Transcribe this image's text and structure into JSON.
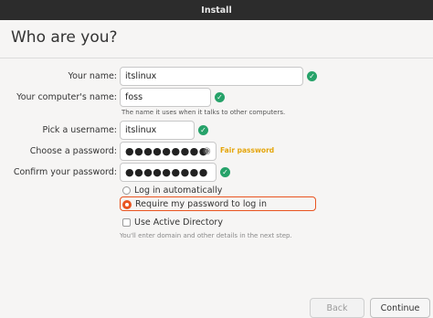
{
  "window": {
    "title": "Install"
  },
  "page": {
    "title": "Who are you?"
  },
  "form": {
    "name": {
      "label": "Your name:",
      "value": "itslinux"
    },
    "computer": {
      "label": "Your computer's name:",
      "value": "foss",
      "hint": "The name it uses when it talks to other computers."
    },
    "username": {
      "label": "Pick a username:",
      "value": "itslinux"
    },
    "password": {
      "label": "Choose a password:",
      "value": "●●●●●●●●●",
      "strength": "Fair password"
    },
    "confirm": {
      "label": "Confirm your password:",
      "value": "●●●●●●●●●"
    }
  },
  "options": {
    "auto_login": {
      "label": "Log in automatically",
      "selected": false
    },
    "require_password": {
      "label": "Require my password to log in",
      "selected": true
    },
    "active_directory": {
      "label": "Use Active Directory",
      "checked": false
    },
    "note": "You'll enter domain and other details in the next step."
  },
  "buttons": {
    "back": "Back",
    "continue": "Continue"
  },
  "colors": {
    "accent": "#e95420",
    "valid": "#26a269",
    "strength": "#e5a50a",
    "titlebar": "#2c2c2c"
  },
  "icons": {
    "valid": "check-circle-icon",
    "reveal": "eye-icon"
  }
}
